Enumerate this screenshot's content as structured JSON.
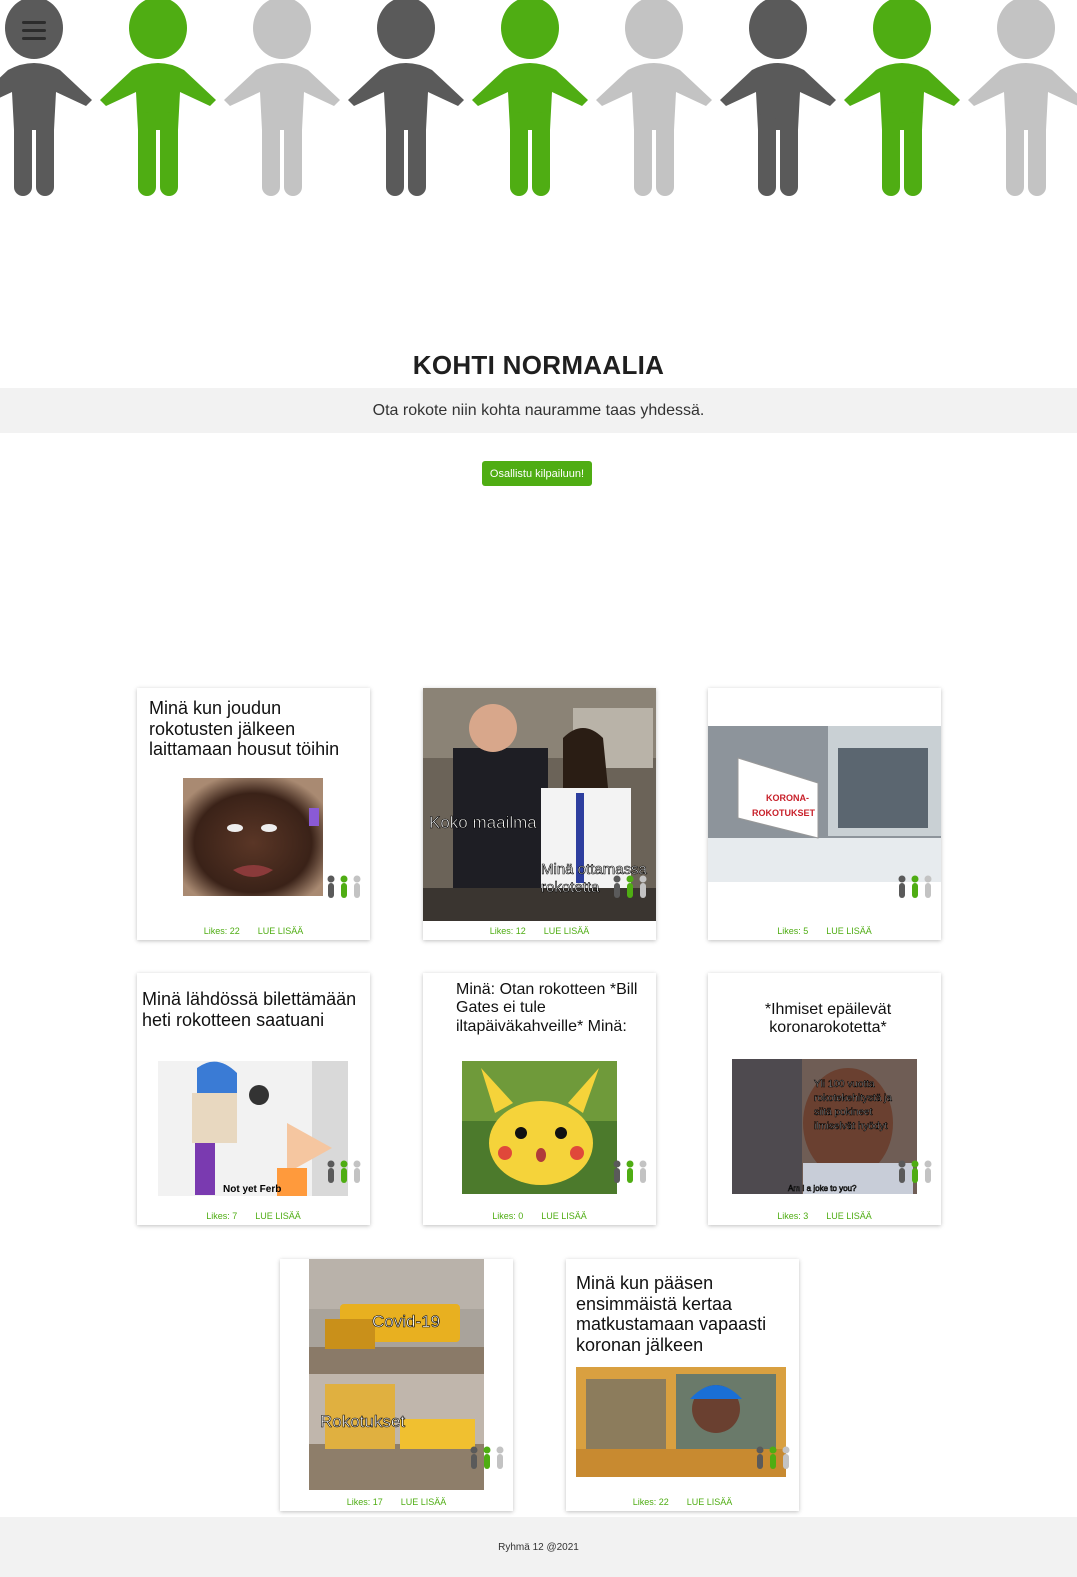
{
  "header": {
    "menu_icon": "hamburger-menu-icon",
    "banner": "people-holding-hands-banner"
  },
  "hero": {
    "title": "KOHTI NORMAALIA",
    "tagline": "Ota rokote niin kohta nauramme taas yhdessä.",
    "cta_label": "Osallistu kilpailuun!"
  },
  "colors": {
    "accent": "#4fad13",
    "dark_gray": "#5a5a5a",
    "light_gray": "#c3c3c3",
    "bar_bg": "#f2f2f2"
  },
  "cards": [
    {
      "caption": "Minä kun joudun rokotusten jälkeen laittamaan housut töihin",
      "likes": "Likes: 22",
      "more": "LUE LISÄÄ"
    },
    {
      "caption": "",
      "overlay_1": "Koko maailma",
      "overlay_2": "Minä ottamassa rokotetta",
      "likes": "Likes: 12",
      "more": "LUE LISÄÄ"
    },
    {
      "caption": "",
      "sign": "KORONA-ROKOTUKSET",
      "likes": "Likes: 5",
      "more": "LUE LISÄÄ"
    },
    {
      "caption": "Minä lähdössä bilettämään heti rokotteen saatuani",
      "image_text": "Not yet Ferb",
      "likes": "Likes: 7",
      "more": "LUE LISÄÄ"
    },
    {
      "caption": "Minä: Otan rokotteen *Bill Gates ei tule iltapäiväkahveille* Minä:",
      "likes": "Likes: 0",
      "more": "LUE LISÄÄ"
    },
    {
      "caption": "*Ihmiset epäilevät koronarokotetta*",
      "overlay_1": "Yli 100 vuotta rokotekehitystä ja siitä pokineet ilmiselvät hyödyt",
      "overlay_2": "Am I a joke to you?",
      "likes": "Likes: 3",
      "more": "LUE LISÄÄ"
    },
    {
      "caption": "",
      "overlay_1": "Covid-19",
      "overlay_2": "Rokotukset",
      "likes": "Likes: 17",
      "more": "LUE LISÄÄ"
    },
    {
      "caption": "Minä kun pääsen ensimmäistä kertaa matkustamaan vapaasti koronan jälkeen",
      "likes": "Likes: 22",
      "more": "LUE LISÄÄ"
    }
  ],
  "footer": {
    "text": "Ryhmä 12 @2021"
  }
}
